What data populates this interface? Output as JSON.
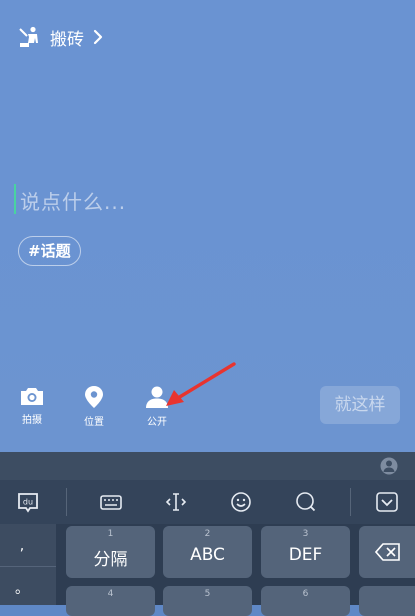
{
  "header": {
    "title": "搬砖"
  },
  "compose": {
    "placeholder": "说点什么...",
    "topic": "#话题"
  },
  "tools": [
    {
      "label": "拍摄",
      "icon": "camera-icon"
    },
    {
      "label": "位置",
      "icon": "location-pin-icon"
    },
    {
      "label": "公开",
      "icon": "person-icon"
    }
  ],
  "submit_label": "就这样",
  "keyboard": {
    "punct": [
      ",",
      "。"
    ],
    "keys": [
      {
        "num": "1",
        "label": "分隔"
      },
      {
        "num": "2",
        "label": "ABC"
      },
      {
        "num": "3",
        "label": "DEF"
      },
      {
        "num": "4",
        "label": ""
      },
      {
        "num": "5",
        "label": ""
      },
      {
        "num": "6",
        "label": ""
      }
    ]
  },
  "colors": {
    "background": "#6a93d2",
    "cursor": "#49d3a0",
    "arrow": "#e8342f",
    "keyboard": "#2e3d52"
  }
}
